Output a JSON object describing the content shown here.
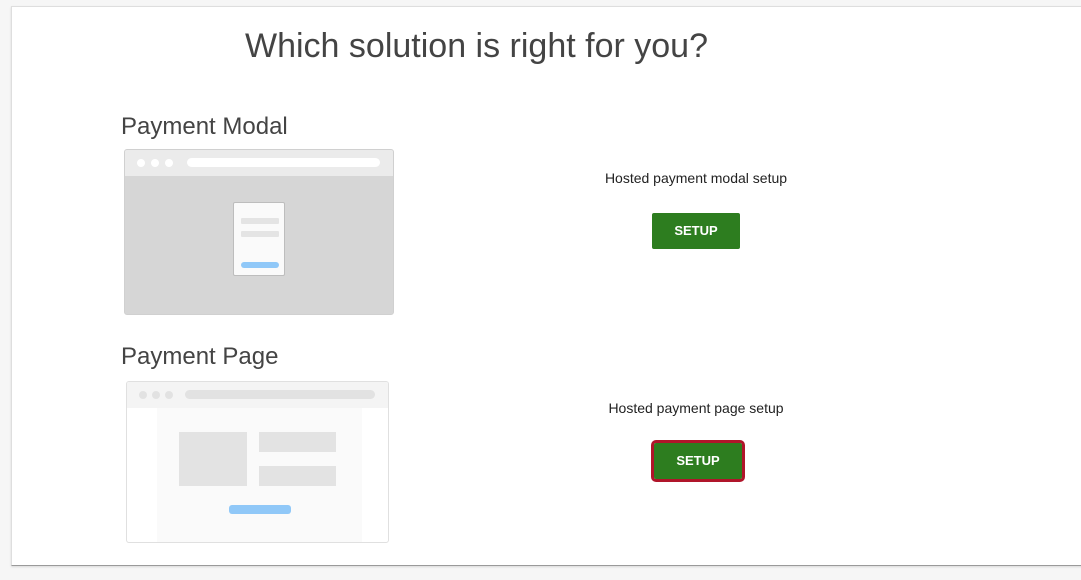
{
  "page_title": "Which solution is right for you?",
  "sections": [
    {
      "title": "Payment Modal",
      "description": "Hosted payment modal setup",
      "button_label": "SETUP"
    },
    {
      "title": "Payment Page",
      "description": "Hosted payment page setup",
      "button_label": "SETUP"
    }
  ],
  "colors": {
    "button_bg": "#2d7d1f",
    "highlight_outline": "#b0152a",
    "illustration_accent": "#90c8f8"
  }
}
